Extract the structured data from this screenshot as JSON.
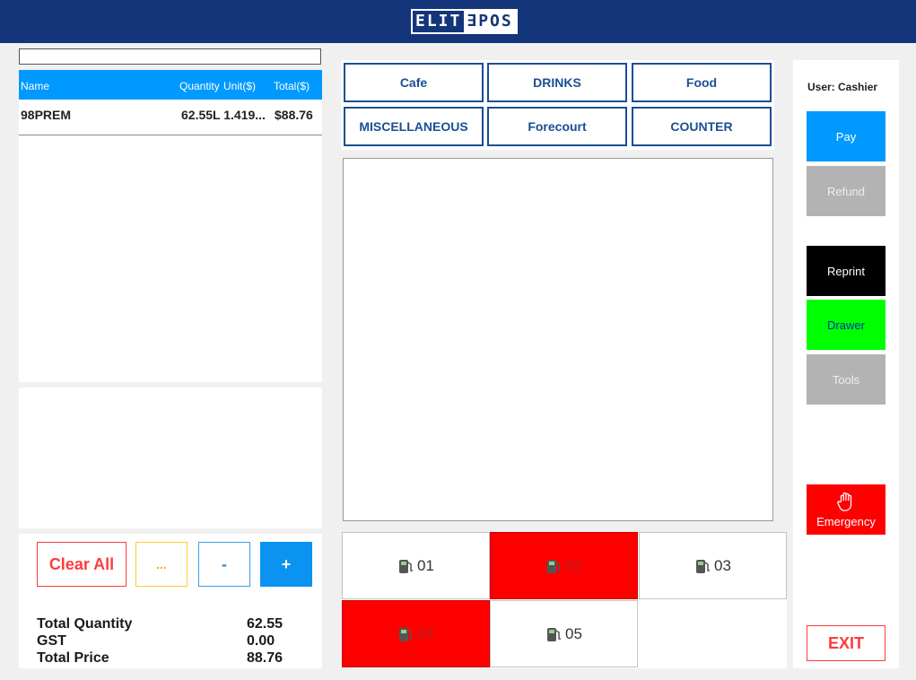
{
  "app": {
    "logo_left": "ELIT",
    "logo_right": "∃POS"
  },
  "search": {
    "value": ""
  },
  "order": {
    "columns": {
      "name": "Name",
      "quantity": "Quantity",
      "unit": "Unit($)",
      "total": "Total($)"
    },
    "rows": [
      {
        "name": "98PREM",
        "qty_unit": "62.55L 1.419...",
        "total": "$88.76"
      }
    ]
  },
  "actions": {
    "clear_all": "Clear All",
    "more": "...",
    "minus": "-",
    "plus": "+"
  },
  "totals": {
    "quantity_label": "Total Quantity",
    "quantity_value": "62.55",
    "gst_label": "GST",
    "gst_value": "0.00",
    "price_label": "Total Price",
    "price_value": "88.76"
  },
  "categories": [
    "Cafe",
    "DRINKS",
    "Food",
    "MISCELLANEOUS",
    "Forecourt",
    "COUNTER"
  ],
  "pumps": [
    {
      "label": "01",
      "active": false
    },
    {
      "label": "02",
      "active": true
    },
    {
      "label": "03",
      "active": false
    },
    {
      "label": "04",
      "active": true
    },
    {
      "label": "05",
      "active": false
    }
  ],
  "sidebar": {
    "user": "User: Cashier",
    "pay": "Pay",
    "refund": "Refund",
    "reprint": "Reprint",
    "drawer": "Drawer",
    "tools": "Tools",
    "emergency": "Emergency",
    "exit": "EXIT"
  },
  "colors": {
    "header": "#14357a",
    "accent_blue": "#0099ff",
    "active_pump": "#ff0000",
    "drawer": "#00ff00",
    "reprint": "#000000",
    "disabled": "#b3b3b3"
  }
}
